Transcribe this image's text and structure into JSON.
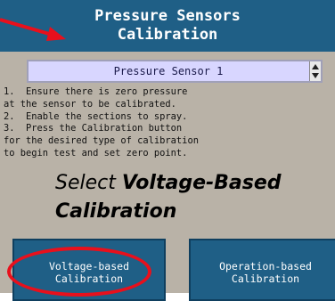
{
  "title": {
    "line1": "Pressure Sensors",
    "line2": "Calibration"
  },
  "selector": {
    "value": "Pressure Sensor 1"
  },
  "instructions": [
    "1.  Ensure there is zero pressure",
    "at the sensor to be calibrated.",
    "2.  Enable the sections to spray.",
    "3.  Press the Calibration button",
    "for the desired type of calibration",
    "to begin test and set zero point."
  ],
  "callout": {
    "prefix": "Select ",
    "bold": "Voltage-Based Calibration"
  },
  "buttons": {
    "voltage": {
      "line1": "Voltage-based",
      "line2": "Calibration"
    },
    "operation": {
      "line1": "Operation-based",
      "line2": "Calibration"
    }
  },
  "colors": {
    "title_bg": "#1f5f86",
    "panel_bg": "#b9b2a7",
    "selector_bg": "#d8d6ff",
    "annotation": "#e8101c"
  }
}
